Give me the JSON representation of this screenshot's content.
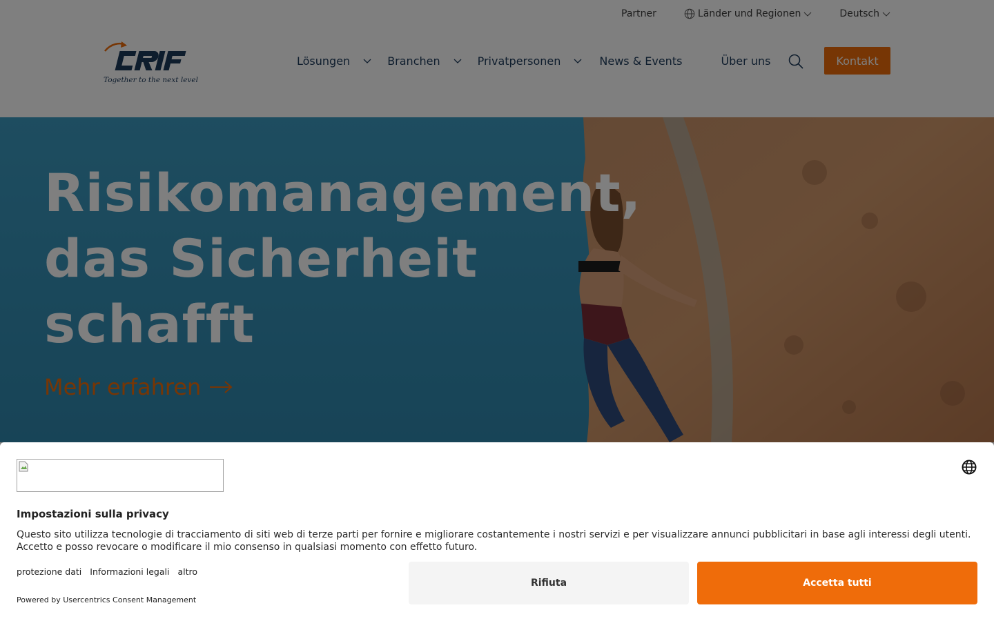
{
  "utility": {
    "partner": "Partner",
    "regions": "Länder und Regionen",
    "language": "Deutsch"
  },
  "logo": {
    "wordmark": "CRIF",
    "tagline": "Together to the next level"
  },
  "nav": {
    "items": [
      {
        "label": "Lösungen",
        "has_dropdown": true
      },
      {
        "label": "Branchen",
        "has_dropdown": true
      },
      {
        "label": "Privatpersonen",
        "has_dropdown": true
      },
      {
        "label": "News & Events",
        "has_dropdown": false
      },
      {
        "label": "Über uns",
        "has_dropdown": false
      }
    ],
    "search_icon": "search-icon",
    "contact": "Kontakt"
  },
  "hero": {
    "title_lines": [
      "Risikomanagement,",
      "das Sicherheit",
      "schafft"
    ],
    "cta": "Mehr erfahren"
  },
  "consent": {
    "title": "Impostazioni sulla privacy",
    "text": "Questo sito utilizza tecnologie di tracciamento di siti web di terze parti per fornire e migliorare costantemente i nostri servizi e per visualizzare annunci pubblicitari in base agli interessi degli utenti. Accetto e posso revocare o modificare il mio consenso in qualsiasi momento con effetto futuro.",
    "links": [
      "protezione dati",
      "Informazioni legali",
      "altro"
    ],
    "powered_by": "Powered by Usercentrics Consent Management",
    "reject": "Rifiuta",
    "accept": "Accetta tutti"
  },
  "colors": {
    "brand_orange": "#ef6c0a",
    "brand_navy": "#1d3a5b",
    "sky_blue": "#3c9ac0"
  }
}
